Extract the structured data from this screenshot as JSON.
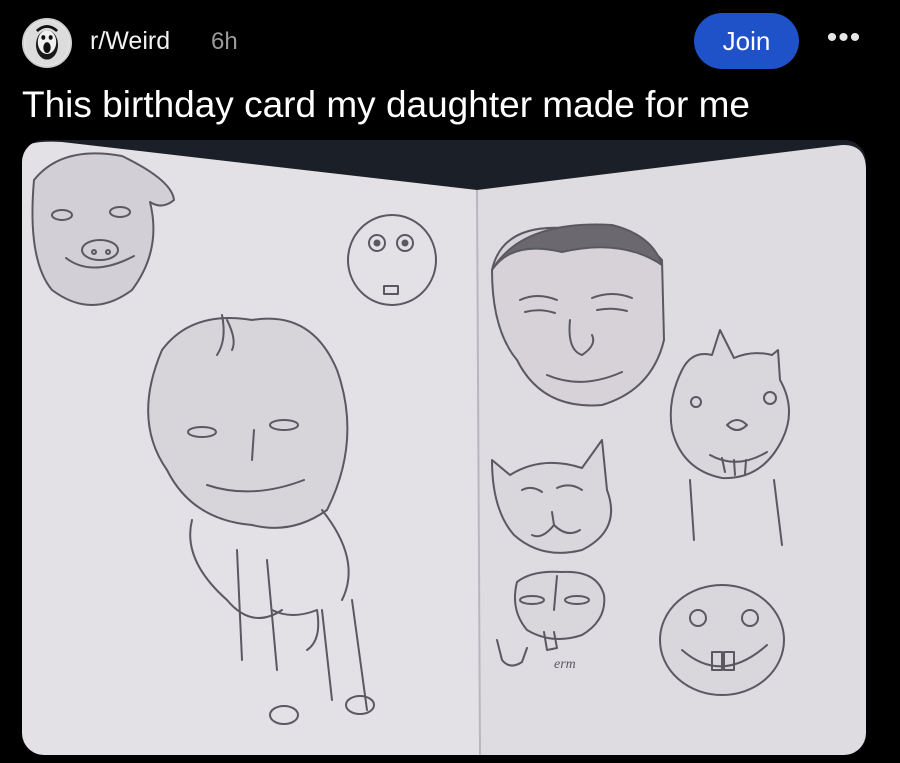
{
  "post": {
    "subreddit": "r/Weird",
    "time_ago": "6h",
    "join_label": "Join",
    "more_icon": "more-horizontal-icon",
    "title": "This birthday card my daughter made for me"
  },
  "drawing": {
    "handwritten_text": "erm"
  },
  "colors": {
    "background": "#000000",
    "join_button": "#1f52c8",
    "time_text": "#9a9a9a",
    "paper": "#e3e0e4"
  }
}
